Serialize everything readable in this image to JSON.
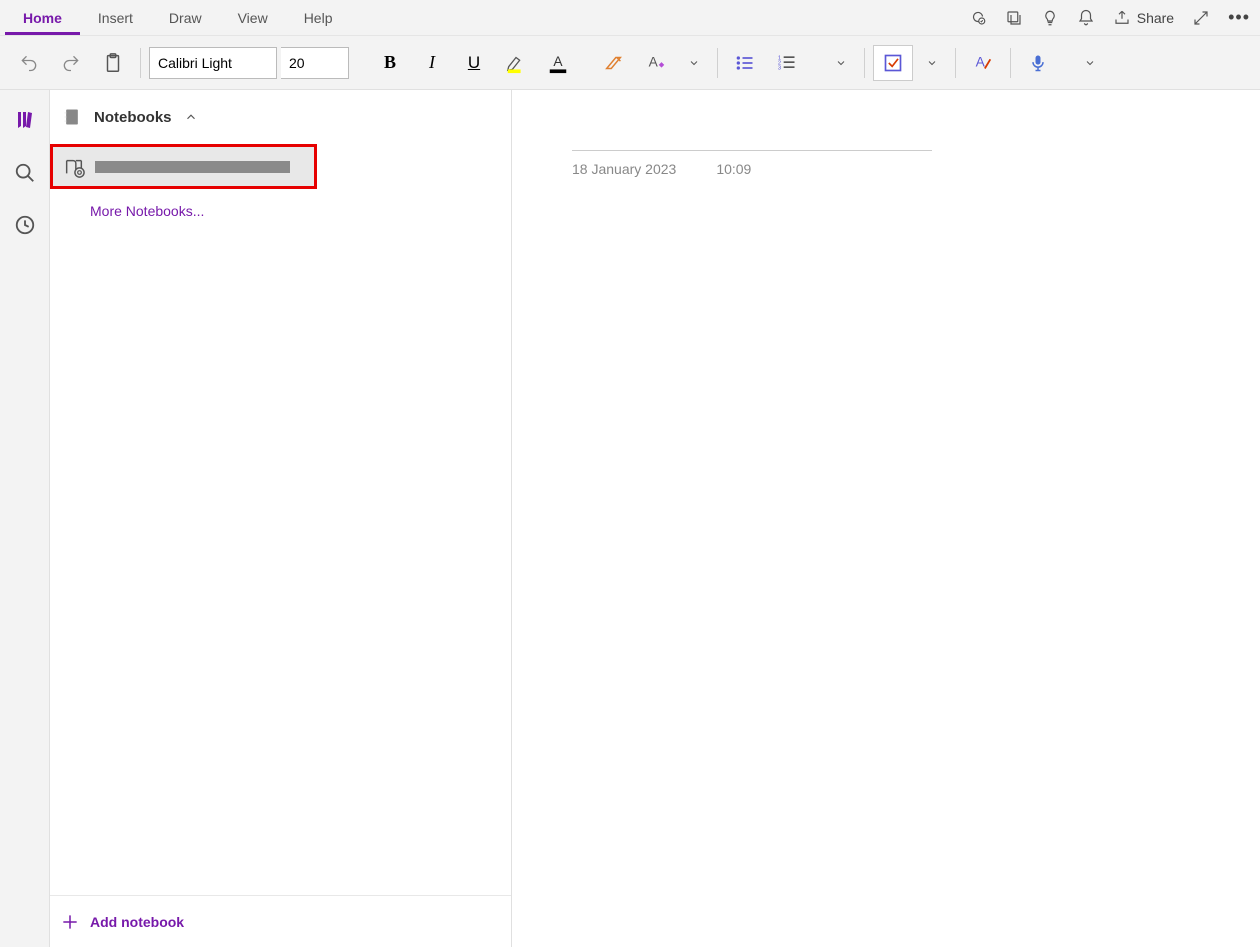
{
  "menu": {
    "home": "Home",
    "insert": "Insert",
    "draw": "Draw",
    "view": "View",
    "help": "Help",
    "share": "Share"
  },
  "ribbon": {
    "font_name": "Calibri Light",
    "font_size": "20"
  },
  "sidebar": {
    "header": "Notebooks",
    "more_notebooks": "More Notebooks...",
    "add_notebook": "Add notebook"
  },
  "note": {
    "date": "18 January 2023",
    "time": "10:09"
  },
  "icons": {
    "highlight_color": "#ffff00",
    "font_color": "#000000",
    "accent": "#7719aa"
  }
}
